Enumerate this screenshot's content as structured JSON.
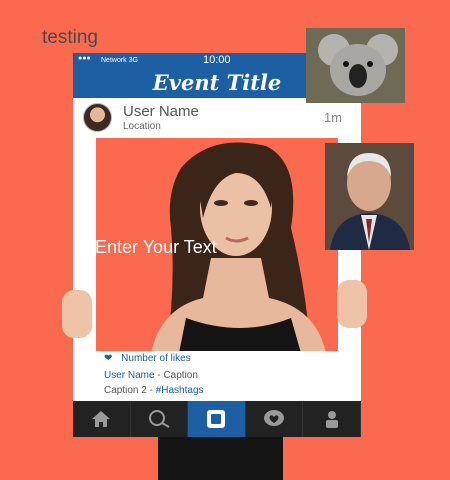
{
  "top_label": "testing",
  "status": {
    "dots": "●●●",
    "network": "Network 3G",
    "time": "10:00"
  },
  "event_title": "Event Title",
  "post": {
    "user_name": "User Name",
    "location": "Location",
    "time_ago": "1m"
  },
  "overlay_text": "Enter Your Text",
  "likes": "Number of likes",
  "caption1": {
    "user": "User Name",
    "text": " - Caption"
  },
  "caption2": {
    "text": "Caption 2 - ",
    "hashtags": "#Hashtags"
  },
  "tabs": [
    "home-icon",
    "search-icon",
    "camera-icon",
    "heart-icon",
    "profile-icon"
  ],
  "colors": {
    "background": "#fb6a4e",
    "brand": "#1d5fa3",
    "tabbar": "#222222"
  }
}
